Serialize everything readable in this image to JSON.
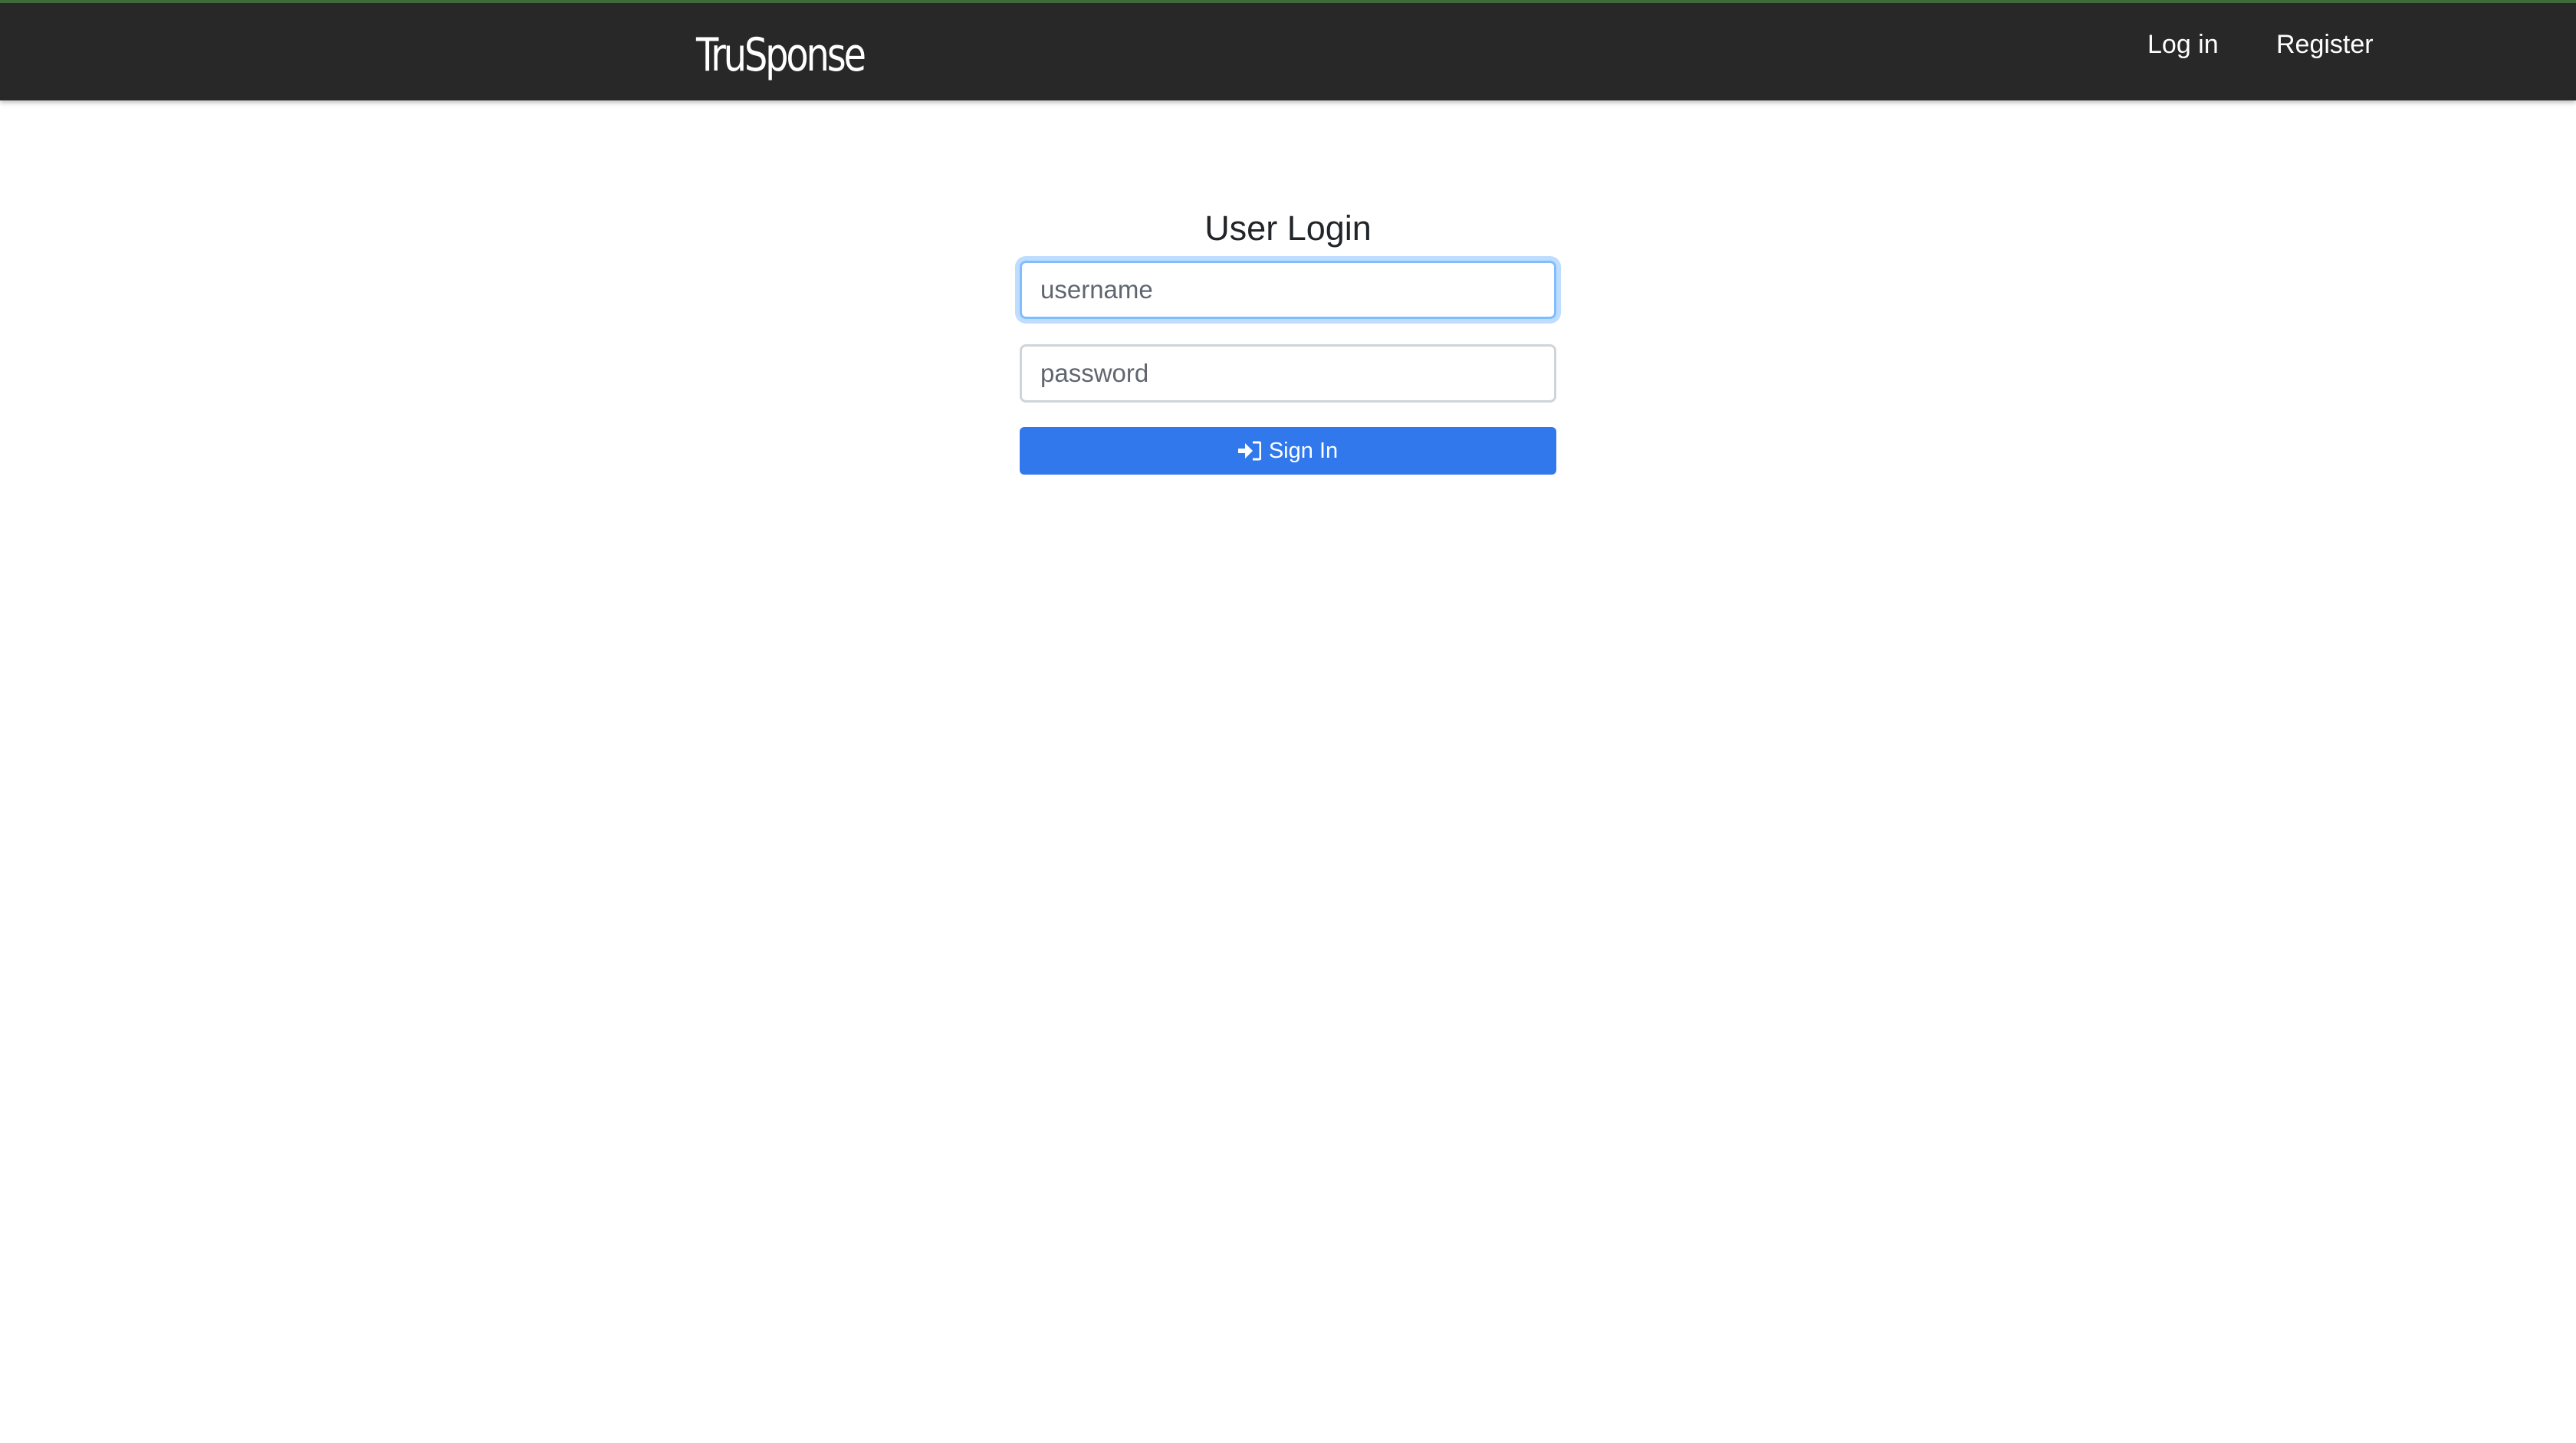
{
  "navbar": {
    "brand": "TruSponse",
    "links": [
      {
        "label": "Log in"
      },
      {
        "label": "Register"
      }
    ]
  },
  "login": {
    "title": "User Login",
    "username": {
      "placeholder": "username",
      "value": ""
    },
    "password": {
      "placeholder": "password",
      "value": ""
    },
    "submit": {
      "label": "Sign In",
      "icon": "sign-in-icon"
    }
  },
  "colors": {
    "navbar_bg": "#282828",
    "primary_button": "#3078ec",
    "focus_ring": "#80bdff"
  }
}
